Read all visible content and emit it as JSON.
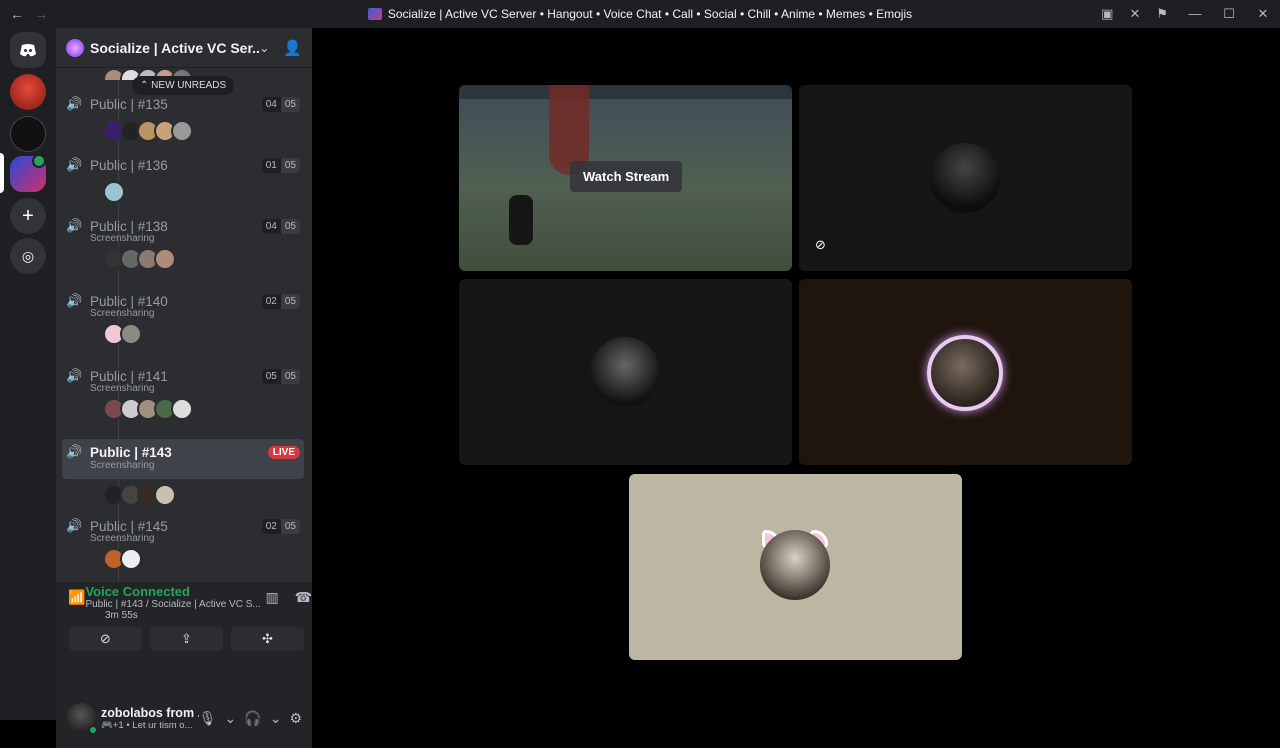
{
  "titlebar": {
    "title": "Socialize | Active VC Server • Hangout • Voice Chat • Call • Social • Chill • Anime • Memes • Emojis",
    "back_icon": "←",
    "forward_icon": "→"
  },
  "server": {
    "name": "Socialize | Active VC Ser...",
    "new_unreads": "NEW UNREADS"
  },
  "channels": [
    {
      "name": "Public | #135",
      "users": "04",
      "limit": "05",
      "sub": "",
      "avatar_count": 5
    },
    {
      "name": "Public | #136",
      "users": "01",
      "limit": "05",
      "sub": "",
      "avatar_count": 1
    },
    {
      "name": "Public | #138",
      "users": "04",
      "limit": "05",
      "sub": "Screensharing",
      "avatar_count": 4
    },
    {
      "name": "Public | #140",
      "users": "02",
      "limit": "05",
      "sub": "Screensharing",
      "avatar_count": 2
    },
    {
      "name": "Public | #141",
      "users": "05",
      "limit": "05",
      "sub": "Screensharing",
      "avatar_count": 5
    },
    {
      "name": "Public | #143",
      "badge": "LIVE",
      "sub": "Screensharing",
      "avatar_count": 4,
      "selected": true
    },
    {
      "name": "Public | #145",
      "users": "02",
      "limit": "05",
      "sub": "Screensharing",
      "avatar_count": 2
    }
  ],
  "voice": {
    "title": "Voice Connected",
    "subtitle": "Public | #143 / Socialize | Active VC S...",
    "time": "3m  55s"
  },
  "user": {
    "name": "zobolabos from ...",
    "status": "+1 •  Let ur tism o..."
  },
  "stage": {
    "watch_stream": "Watch Stream"
  },
  "colors": {
    "accent_green": "#23a55a",
    "live_red": "#da373c",
    "sidebar_bg": "#2b2d31"
  }
}
